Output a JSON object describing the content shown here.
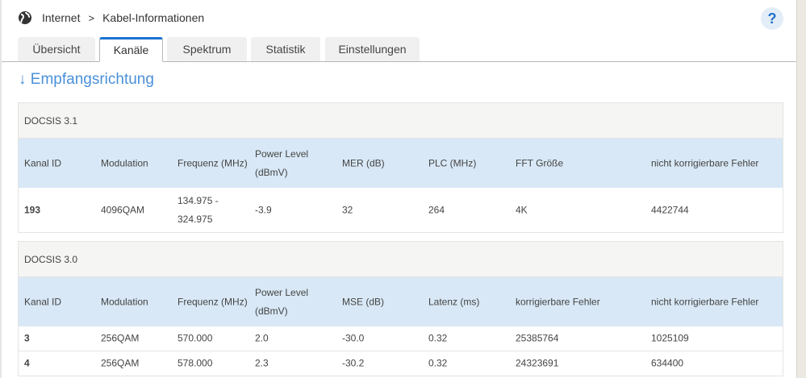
{
  "breadcrumb": {
    "section": "Internet",
    "page": "Kabel-Informationen"
  },
  "help_label": "?",
  "tabs": [
    "Übersicht",
    "Kanäle",
    "Spektrum",
    "Statistik",
    "Einstellungen"
  ],
  "heading": "↓ Empfangsrichtung",
  "docsis31": {
    "title": "DOCSIS 3.1",
    "headers": [
      "Kanal ID",
      "Modulation",
      "Frequenz (MHz)",
      "Power Level (dBmV)",
      "MER (dB)",
      "PLC (MHz)",
      "FFT Größe",
      "nicht korrigierbare Fehler"
    ],
    "rows": [
      [
        "193",
        "4096QAM",
        "134.975 - 324.975",
        "-3.9",
        "32",
        "264",
        "4K",
        "4422744"
      ]
    ]
  },
  "docsis30": {
    "title": "DOCSIS 3.0",
    "headers": [
      "Kanal ID",
      "Modulation",
      "Frequenz (MHz)",
      "Power Level (dBmV)",
      "MSE (dB)",
      "Latenz (ms)",
      "korrigierbare Fehler",
      "nicht korrigierbare Fehler"
    ],
    "rows": [
      [
        "3",
        "256QAM",
        "570.000",
        "2.0",
        "-30.0",
        "0.32",
        "25385764",
        "1025109"
      ],
      [
        "4",
        "256QAM",
        "578.000",
        "2.3",
        "-30.2",
        "0.32",
        "24323691",
        "634400"
      ]
    ]
  }
}
